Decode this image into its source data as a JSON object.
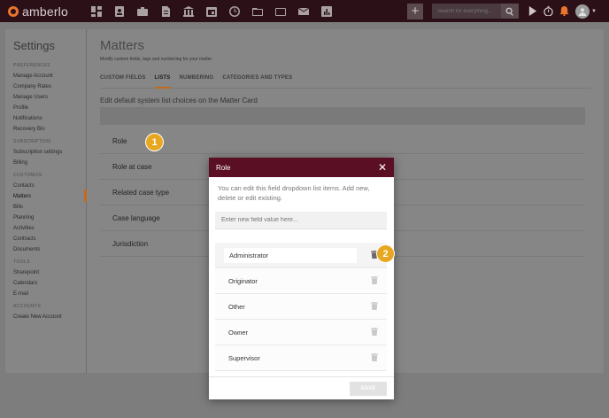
{
  "topbar": {
    "logo": "amberlo",
    "nav_icons": [
      "dashboard-icon",
      "contacts-icon",
      "matters-icon",
      "documents-icon",
      "billing-icon",
      "calendar-icon",
      "timesheet-icon",
      "folder-icon",
      "files-icon",
      "mail-icon",
      "reports-icon"
    ],
    "search_placeholder": "Search for everything...",
    "plus": "+"
  },
  "sidebar": {
    "title": "Settings",
    "sections": [
      {
        "heading": "PREFERENCES",
        "items": [
          "Manage Account",
          "Company Rates",
          "Manage Users",
          "Profile",
          "Notifications",
          "Recovery Bin"
        ]
      },
      {
        "heading": "SUBSCRIPTION",
        "items": [
          "Subscription settings",
          "Billing"
        ]
      },
      {
        "heading": "CUSTOMIZE",
        "items": [
          "Contacts",
          "Matters",
          "Bills",
          "Planning",
          "Activities",
          "Contracts",
          "Documents"
        ]
      },
      {
        "heading": "TOOLS",
        "items": [
          "Sharepoint",
          "Calendars",
          "E-mail"
        ]
      },
      {
        "heading": "ACCOUNTS",
        "items": [
          "Create New Account"
        ]
      }
    ],
    "active_item": "Matters"
  },
  "main": {
    "title": "Matters",
    "subtitle": "Modify custom fields, tags and numbering for your matter",
    "tabs": [
      "CUSTOM FIELDS",
      "LISTS",
      "NUMBERING",
      "CATEGORIES AND TYPES"
    ],
    "active_tab": "LISTS",
    "description": "Edit default system list choices on the Matter Card",
    "list_rows": [
      "Role",
      "Role at case",
      "Related case type",
      "Case language",
      "Jurisdiction"
    ]
  },
  "badges": {
    "first": "1",
    "second": "2"
  },
  "modal": {
    "title": "Role",
    "close": "✕",
    "description": "You can edit this field dropdown list items. Add new, delete or edit existing.",
    "input_placeholder": "Enter new field value here...",
    "items": [
      "Administrator",
      "Originator",
      "Other",
      "Owner",
      "Supervisor"
    ],
    "save_label": "SAVE"
  },
  "colors": {
    "topbar": "#2c1018",
    "modal_header": "#5a0f24",
    "accent": "#c46a1c",
    "badge": "#e8a721"
  }
}
